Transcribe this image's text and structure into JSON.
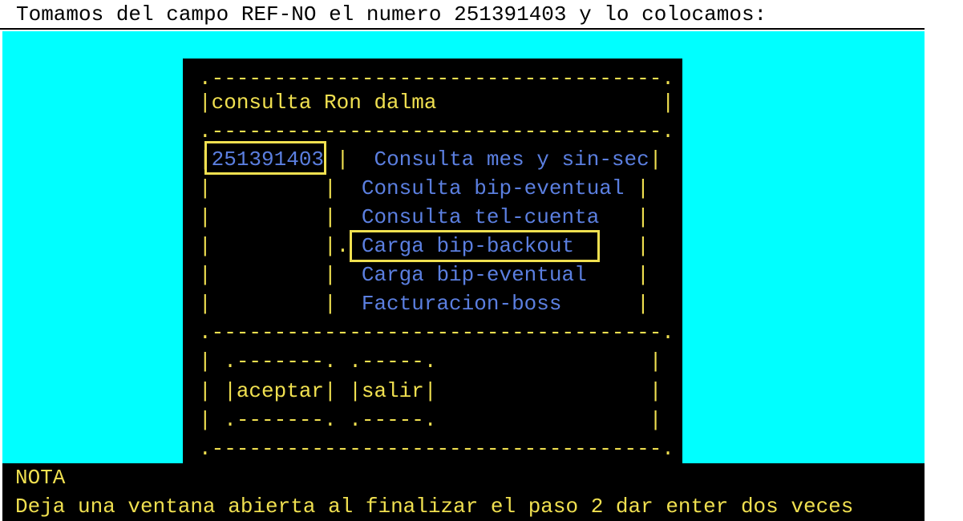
{
  "header": {
    "text": "Tomamos del campo REF-NO el numero 251391403 y lo colocamos:"
  },
  "dialog": {
    "border_top": ".------------------------------------.",
    "title": "consulta Ron dalma",
    "ref_no_value": "251391403",
    "menu": [
      "Consulta mes y sin-sec",
      "Consulta bip-eventual",
      "Consulta tel-cuenta",
      "Carga bip-backout",
      "Carga bip-eventual",
      "Facturacion-boss"
    ],
    "selected_marker": ".",
    "btn_border": ".-------.",
    "btn_border_short": ".-----.",
    "accept_label": "aceptar",
    "exit_label": "salir"
  },
  "note": {
    "label": "NOTA",
    "text": "Deja una ventana abierta al finalizar el paso 2 dar enter dos veces"
  },
  "colors": {
    "background": "#00ffff",
    "terminal": "#000000",
    "frame": "#f0e050",
    "menu": "#5b7fe0"
  }
}
